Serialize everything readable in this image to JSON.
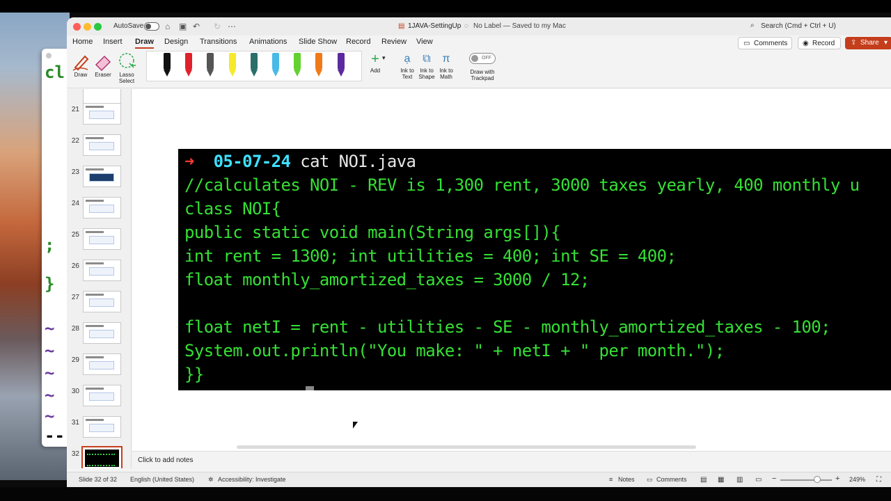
{
  "window": {
    "autosave_label": "AutoSave",
    "document_title": "1JAVA-SettingUp",
    "label_status": "No Label — Saved to my Mac",
    "search_placeholder": "Search (Cmd + Ctrl + U)"
  },
  "menu": {
    "items": [
      "Home",
      "Insert",
      "Draw",
      "Design",
      "Transitions",
      "Animations",
      "Slide Show",
      "Record",
      "Review",
      "View"
    ],
    "active": "Draw",
    "comments_label": "Comments",
    "record_label": "Record",
    "share_label": "Share"
  },
  "ribbon": {
    "draw_label": "Draw",
    "eraser_label": "Eraser",
    "lasso_label_1": "Lasso",
    "lasso_label_2": "Select",
    "add_label": "Add",
    "ink_text_1": "Ink to",
    "ink_text_2": "Text",
    "ink_shape_1": "Ink to",
    "ink_shape_2": "Shape",
    "ink_math_1": "Ink to",
    "ink_math_2": "Math",
    "trackpad_1": "Draw with",
    "trackpad_2": "Trackpad",
    "toggle_state": "OFF",
    "pen_colors": [
      "#111111",
      "#e0212b",
      "#555555",
      "#f5e92c",
      "#2a6f6a",
      "#49b9e8",
      "#63d12f",
      "#f07a1a",
      "#5b2a9e"
    ]
  },
  "thumbnails": {
    "numbers": [
      "21",
      "22",
      "23",
      "24",
      "25",
      "26",
      "27",
      "28",
      "29",
      "30",
      "31",
      "32"
    ],
    "selected": "32"
  },
  "terminal": {
    "prompt_arrow": "➜",
    "prompt_date": "05-07-24",
    "prompt_command": "cat NOI.java",
    "lines": [
      "//calculates NOI - REV is 1,300 rent, 3000 taxes yearly, 400 monthly u",
      "class NOI{",
      "public static void main(String args[]){",
      "int rent = 1300; int utilities = 400; int SE = 400;",
      "float monthly_amortized_taxes = 3000 / 12;",
      "",
      "float netI = rent - utilities - SE - monthly_amortized_taxes - 100;",
      "System.out.println(\"You make: \" + netI + \" per month.\");",
      "}}"
    ]
  },
  "notes_placeholder": "Click to add notes",
  "status": {
    "slide_info": "Slide 32 of 32",
    "language": "English (United States)",
    "accessibility": "Accessibility: Investigate",
    "notes_label": "Notes",
    "comments_label": "Comments",
    "zoom": "249%"
  },
  "background_terminal": {
    "line1": "cl",
    "line2": ";",
    "line3": "}",
    "tilde": "~",
    "dashes": "--"
  }
}
